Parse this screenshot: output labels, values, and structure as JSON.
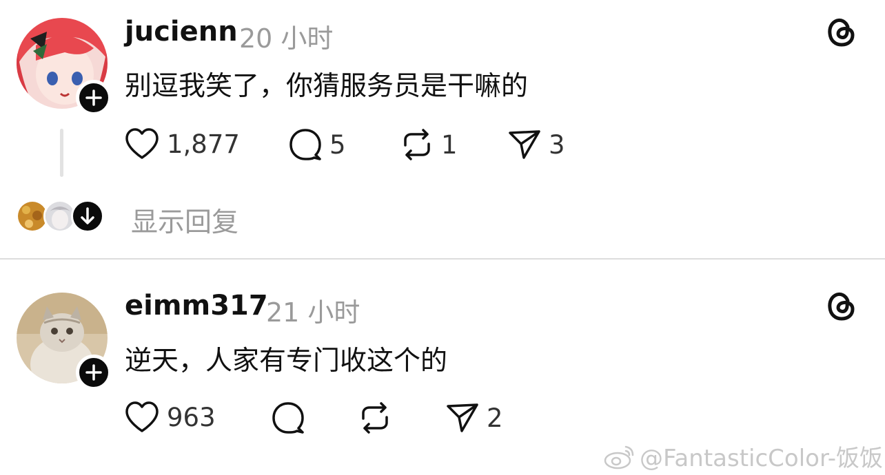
{
  "posts": [
    {
      "username": "jucienn",
      "time": "20 小时",
      "text": "别逗我笑了，你猜服务员是干嘛的",
      "likes": "1,877",
      "replies": "5",
      "reposts": "1",
      "shares": "3",
      "show_replies_label": "显示回复"
    },
    {
      "username": "eimm317",
      "time": "21 小时",
      "text": "逆天，人家有专门收这个的",
      "likes": "963",
      "replies": "",
      "reposts": "",
      "shares": "2"
    }
  ],
  "watermark": "@FantasticColor-饭饭",
  "icons": [
    "threads-icon",
    "heart-icon",
    "comment-icon",
    "repost-icon",
    "send-icon",
    "plus-icon",
    "arrow-down-icon",
    "weibo-icon"
  ]
}
